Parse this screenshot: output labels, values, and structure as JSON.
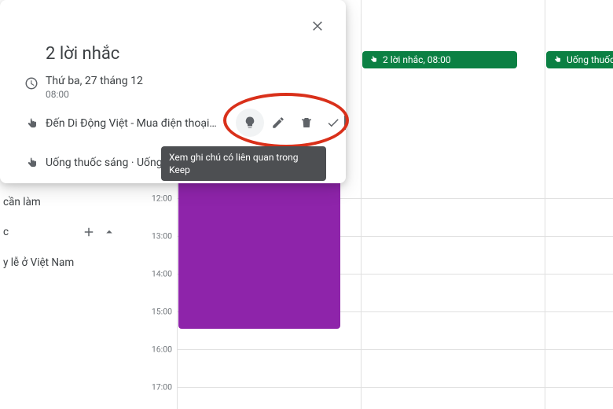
{
  "card": {
    "title": "2 lời nhắc",
    "date": "Thứ ba, 27 tháng 12",
    "time": "08:00",
    "reminders": [
      "Đến Di Động Việt - Mua điện thoại…",
      "Uống thuốc sáng · Uống thuốc sán"
    ]
  },
  "tooltip": "Xem ghi chú có liên quan trong Keep",
  "grid": {
    "hours": [
      "12:00",
      "13:00",
      "14:00",
      "15:00",
      "16:00",
      "17:00"
    ]
  },
  "chips": {
    "c1": "2 lời nhắc, 08:00",
    "c2": "Uống thuốc sán"
  },
  "sidebar": {
    "items": [
      "cần làm",
      "c",
      "y lễ ở Việt Nam"
    ]
  }
}
